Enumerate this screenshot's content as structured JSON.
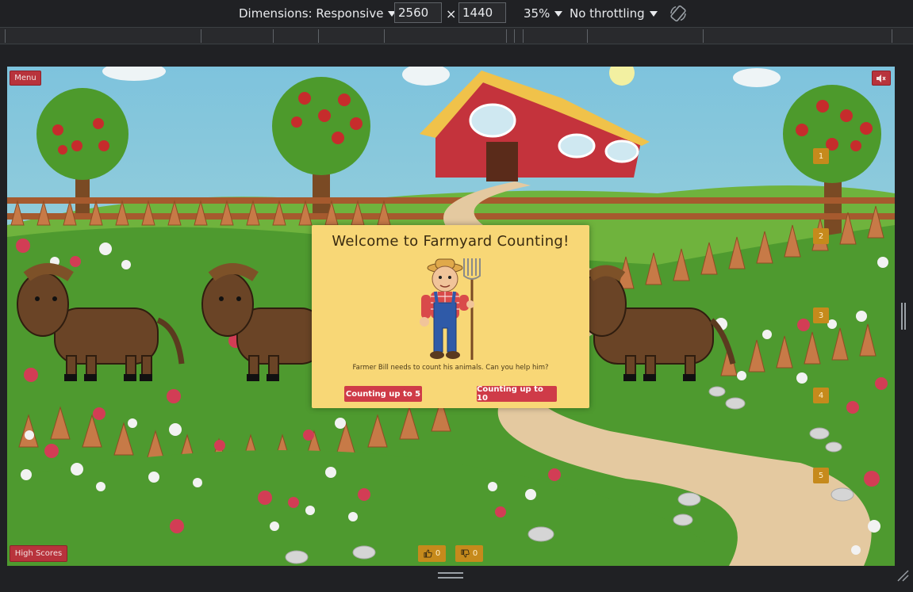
{
  "devtools": {
    "dimensions_label": "Dimensions: Responsive",
    "width": "2560",
    "height": "1440",
    "times": "×",
    "zoom": "35%",
    "throttling": "No throttling",
    "rotate_icon": "rotate-icon"
  },
  "game": {
    "menu_label": "Menu",
    "mute_icon": "speaker-mute-icon",
    "high_scores_label": "High Scores",
    "counters": [
      "1",
      "2",
      "3",
      "4",
      "5"
    ],
    "modal": {
      "title": "Welcome to Farmyard Counting!",
      "subtitle": "Farmer Bill needs to count his animals. Can you help him?",
      "button_5": "Counting up to 5",
      "button_10": "Counting up to 10"
    },
    "votes": {
      "up_count": "0",
      "down_count": "0"
    }
  },
  "colors": {
    "modal_bg": "#f8d776",
    "button_red": "#cf3b48",
    "badge_gold": "#c68a1c",
    "grass": "#4e9a2f"
  }
}
